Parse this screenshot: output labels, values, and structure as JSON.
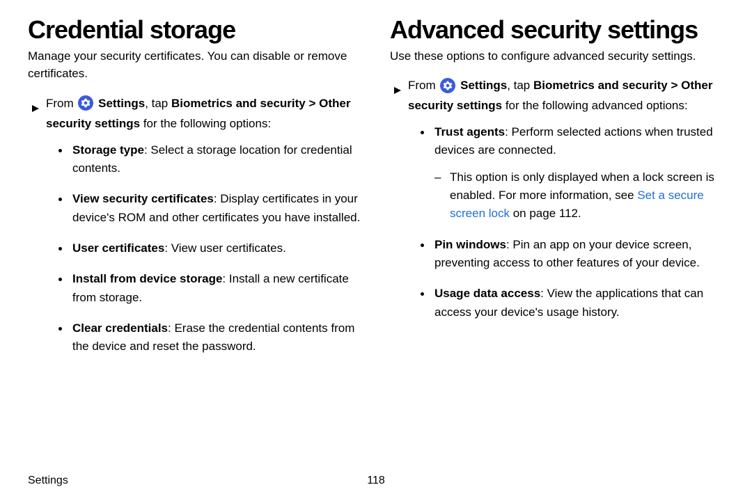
{
  "left": {
    "heading": "Credential storage",
    "intro": "Manage your security certificates. You can disable or remove certificates.",
    "from_prefix": "From ",
    "from_settings": "Settings",
    "from_mid": ", tap ",
    "from_path1": "Biometrics and security",
    "from_chev": " > ",
    "from_path2": "Other security settings",
    "from_suffix": " for the following options:",
    "items": [
      {
        "label": "Storage type",
        "text": ": Select a storage location for credential contents."
      },
      {
        "label": "View security certificates",
        "text": ": Display certificates in your device's ROM and other certificates you have installed."
      },
      {
        "label": "User certificates",
        "text": ": View user certificates."
      },
      {
        "label": "Install from device storage",
        "text": ": Install a new certificate from storage."
      },
      {
        "label": "Clear credentials",
        "text": ": Erase the credential contents from the device and reset the password."
      }
    ]
  },
  "right": {
    "heading": "Advanced security settings",
    "intro": "Use these options to configure advanced security settings.",
    "from_prefix": "From ",
    "from_settings": "Settings",
    "from_mid": ", tap ",
    "from_path1": "Biometrics and security",
    "from_chev": " > ",
    "from_path2": "Other security settings",
    "from_suffix": " for the following advanced options:",
    "trust_label": "Trust agents",
    "trust_text": ": Perform selected actions when trusted devices are connected.",
    "trust_note_pre": "This option is only displayed when a lock screen is enabled. For more information, see ",
    "trust_link": "Set a secure screen lock",
    "trust_note_post": " on page 112.",
    "pin_label": "Pin windows",
    "pin_text": ": Pin an app on your device screen, preventing access to other features of your device.",
    "usage_label": "Usage data access",
    "usage_text": ": View the applications that can access your device's usage history."
  },
  "footer": {
    "section": "Settings",
    "page": "118"
  }
}
